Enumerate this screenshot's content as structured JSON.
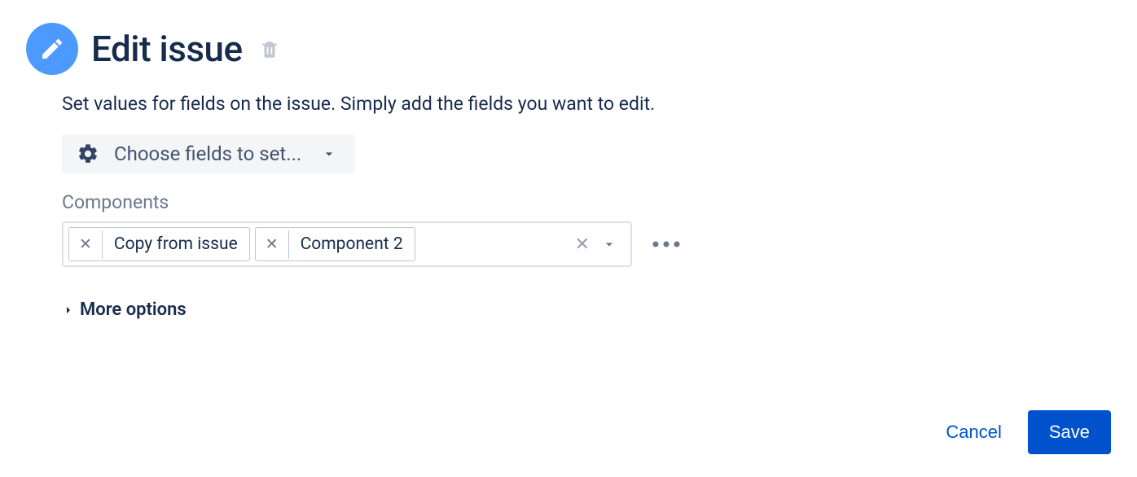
{
  "header": {
    "title": "Edit issue"
  },
  "description": "Set values for fields on the issue. Simply add the fields you want to edit.",
  "choose_fields": {
    "label": "Choose fields to set..."
  },
  "fields": {
    "components": {
      "label": "Components",
      "tags": [
        {
          "label": "Copy from issue"
        },
        {
          "label": "Component 2"
        }
      ]
    }
  },
  "more_options": {
    "label": "More options"
  },
  "footer": {
    "cancel": "Cancel",
    "save": "Save"
  }
}
